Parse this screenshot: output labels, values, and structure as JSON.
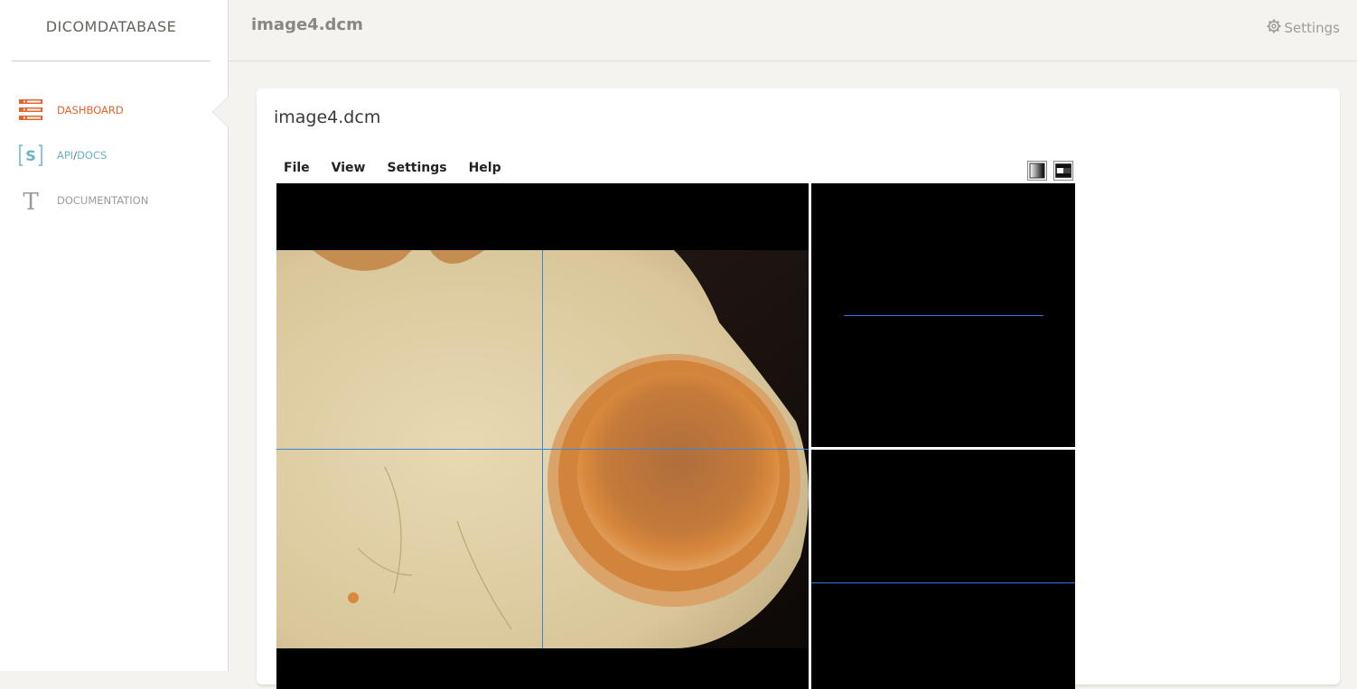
{
  "sidebar": {
    "brand": "DICOMDATABASE",
    "items": [
      {
        "label": "DASHBOARD",
        "icon": "dashboard-list-icon",
        "active": true
      },
      {
        "label_a": "API",
        "label_sep": "/",
        "label_b": "DOCS",
        "icon": "swagger-s-icon"
      },
      {
        "label": "DOCUMENTATION",
        "icon": "text-t-icon"
      }
    ]
  },
  "header": {
    "title": "image4.dcm",
    "settings_label": "Settings",
    "settings_icon": "gear-icon"
  },
  "card": {
    "title": "image4.dcm",
    "menu": [
      "File",
      "View",
      "Settings",
      "Help"
    ],
    "tools": [
      "window-level-icon",
      "layout-icon"
    ]
  },
  "colors": {
    "accent": "#e8632b",
    "api": "#68b3c8",
    "crosshair": "#3a86d8"
  }
}
